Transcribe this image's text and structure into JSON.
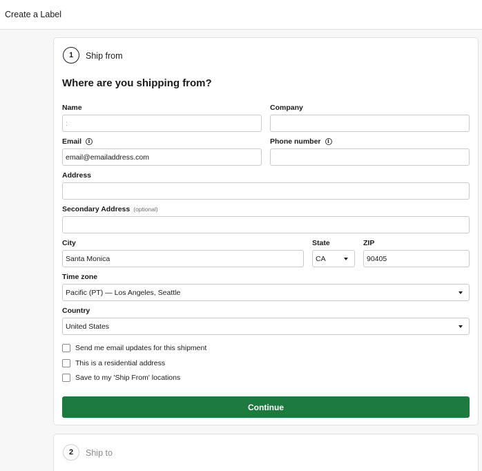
{
  "header": {
    "title": "Create a Label"
  },
  "step1": {
    "number": "1",
    "title": "Ship from",
    "heading": "Where are you shipping from?",
    "fields": {
      "name": {
        "label": "Name",
        "value": "",
        "placeholder": ":"
      },
      "company": {
        "label": "Company",
        "value": ""
      },
      "email": {
        "label": "Email",
        "value": "email@emailaddress.com"
      },
      "phone": {
        "label": "Phone number",
        "value": ""
      },
      "address": {
        "label": "Address",
        "value": ""
      },
      "secondary_address": {
        "label": "Secondary Address",
        "optional": "(optional)",
        "value": ""
      },
      "city": {
        "label": "City",
        "value": "Santa Monica"
      },
      "state": {
        "label": "State",
        "value": "CA"
      },
      "zip": {
        "label": "ZIP",
        "value": "90405"
      },
      "timezone": {
        "label": "Time zone",
        "value": "Pacific (PT) — Los Angeles, Seattle"
      },
      "country": {
        "label": "Country",
        "value": "United States"
      }
    },
    "checkboxes": [
      {
        "label": "Send me email updates for this shipment",
        "checked": false
      },
      {
        "label": "This is a residential address",
        "checked": false
      },
      {
        "label": "Save to my 'Ship From' locations",
        "checked": false
      }
    ],
    "continue_label": "Continue"
  },
  "step2": {
    "number": "2",
    "title": "Ship to"
  },
  "colors": {
    "primary": "#1d7a3e",
    "border": "#c9c9c9",
    "background": "#f7f7f7"
  }
}
